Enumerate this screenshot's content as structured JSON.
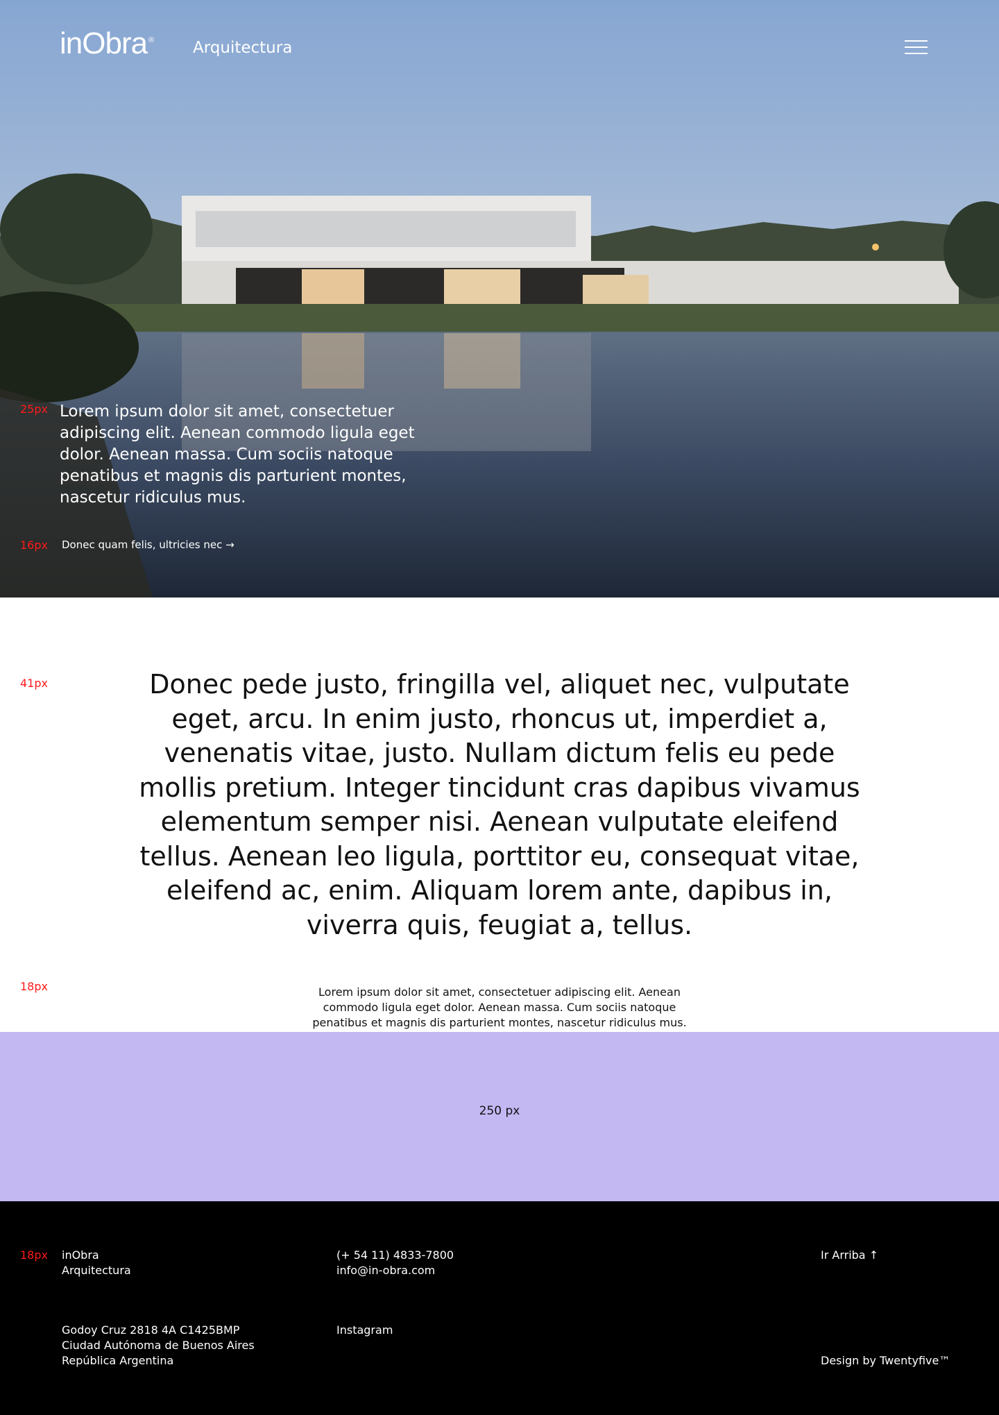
{
  "header": {
    "logo": "inObra",
    "logo_mark": "®",
    "subtitle": "Arquitectura",
    "menu_icon": "hamburger-menu-icon"
  },
  "hero": {
    "text": "Lorem ipsum dolor sit amet, consectetuer adipiscing elit. Aenean commodo ligula eget dolor. Aenean massa. Cum sociis natoque penatibus et magnis dis parturient montes, nascetur ridiculus mus.",
    "link": "Donec quam felis, ultricies nec →",
    "text_size_tag": "25px",
    "link_size_tag": "16px"
  },
  "statement": {
    "text": "Donec pede justo, fringilla vel, aliquet nec, vulputate eget, arcu. In enim justo, rhoncus ut, imperdiet a, venenatis vitae, justo. Nullam dictum felis eu pede mollis pretium. Integer tincidunt cras dapibus vivamus elementum semper nisi. Aenean vulputate eleifend tellus. Aenean leo ligula, porttitor eu, consequat vitae, eleifend ac, enim. Aliquam lorem ante, dapibus in, viverra quis, feugiat a, tellus.",
    "size_tag": "41px"
  },
  "note": {
    "text": "Lorem ipsum dolor sit amet, consectetuer adipiscing elit. Aenean commodo ligula eget dolor. Aenean massa. Cum sociis natoque penatibus et magnis dis parturient montes, nascetur ridiculus mus.",
    "size_tag": "18px"
  },
  "spacer": {
    "label": "250 px",
    "color": "#c3b8f2"
  },
  "footer": {
    "size_tag": "18px",
    "company_line1": "inObra",
    "company_line2": "Arquitectura",
    "phone": "(+ 54 11) 4833-7800",
    "email": "info@in-obra.com",
    "back_to_top": "Ir Arriba ↑",
    "address_line1": "Godoy Cruz 2818 4A C1425BMP",
    "address_line2": "Ciudad Autónoma de Buenos Aires",
    "address_line3": "República Argentina",
    "instagram": "Instagram",
    "credit": "Design by Twentyfive™"
  }
}
